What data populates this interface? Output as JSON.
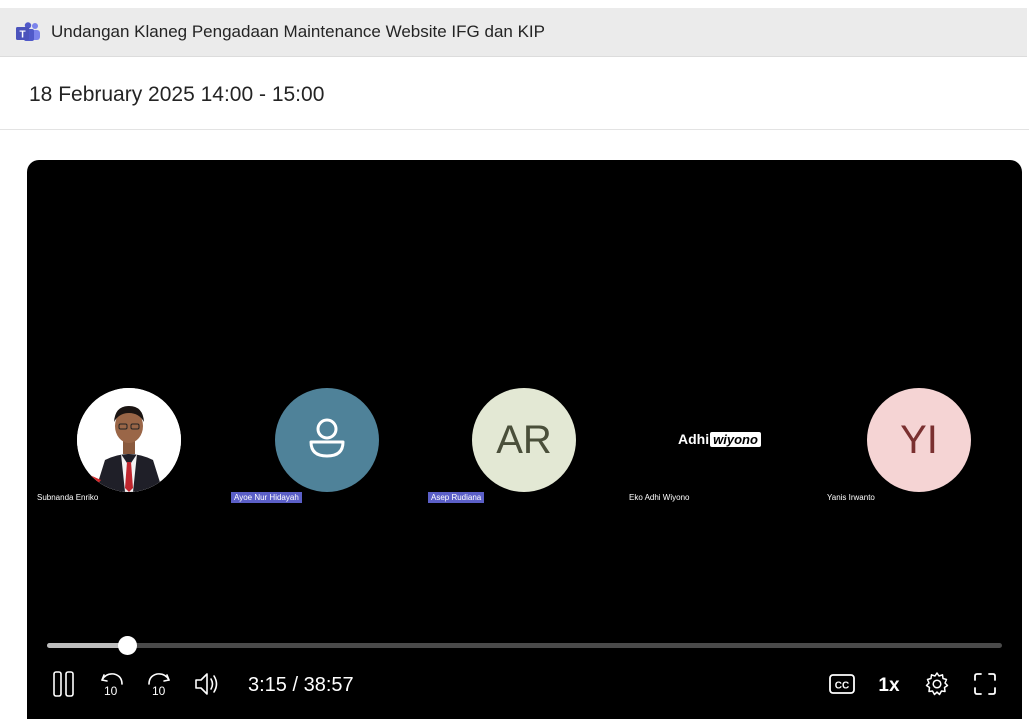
{
  "window": {
    "title": "Undangan Klaneg Pengadaan Maintenance Website IFG dan KIP",
    "app_icon": "teams-icon"
  },
  "meeting": {
    "datetime": "18 February 2025 14:00 - 15:00"
  },
  "participants": [
    {
      "name": "Subnanda Enriko",
      "type": "photo"
    },
    {
      "name": "Ayoe Nur Hidayah",
      "type": "person-icon",
      "color": "#4f8299"
    },
    {
      "name": "Asep Rudiana",
      "initials": "AR",
      "color": "#e3e8d4",
      "text_color": "#4a4f3a"
    },
    {
      "name": "Eko Adhi Wiyono",
      "type": "logo",
      "logo_text_1": "Adhi",
      "logo_text_2": "wiyono"
    },
    {
      "name": "Yanis Irwanto",
      "initials": "YI",
      "color": "#f5d4d4",
      "text_color": "#7a3030"
    }
  ],
  "player": {
    "current_time": "3:15",
    "total_time": "38:57",
    "time_display": "3:15 / 38:57",
    "progress_fraction": 0.084,
    "speed": "1x",
    "controls": [
      "pause-icon",
      "rewind-10-icon",
      "forward-10-icon",
      "volume-icon",
      "captions-icon",
      "settings-icon",
      "fullscreen-icon"
    ],
    "skip_label": "10"
  }
}
